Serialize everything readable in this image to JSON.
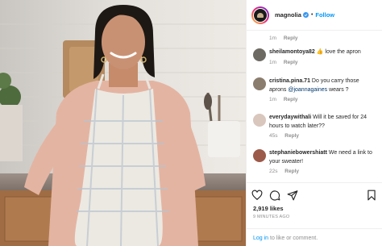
{
  "post": {
    "username": "magnolia",
    "follow_label": "Follow",
    "separator": "•"
  },
  "comments": [
    {
      "time": "1m",
      "reply": "Reply"
    },
    {
      "user": "sheilamontoya82",
      "text": "👍 love the apron",
      "time": "1m",
      "reply": "Reply"
    },
    {
      "user": "cristina.pina.71",
      "text_before": "Do you carry those aprons ",
      "mention": "@joannagaines",
      "text_after": " wears ?",
      "time": "1m",
      "reply": "Reply"
    },
    {
      "user": "everydaywithali",
      "text": "Will it be saved for 24 hours to watch later??",
      "time": "45s",
      "reply": "Reply"
    },
    {
      "user": "stephaniebowershiatt",
      "text": "We need a link to your sweater!",
      "time": "22s",
      "reply": "Reply"
    }
  ],
  "actions": {
    "likes": "2,919 likes",
    "time_ago": "9 MINUTES AGO",
    "login_link": "Log in",
    "login_rest": " to like or comment."
  },
  "colors": {
    "link": "#0095f6",
    "muted": "#8e8e8e",
    "text": "#262626"
  },
  "icons": [
    "heart-icon",
    "comment-icon",
    "share-icon",
    "bookmark-icon",
    "verified-badge-icon"
  ]
}
